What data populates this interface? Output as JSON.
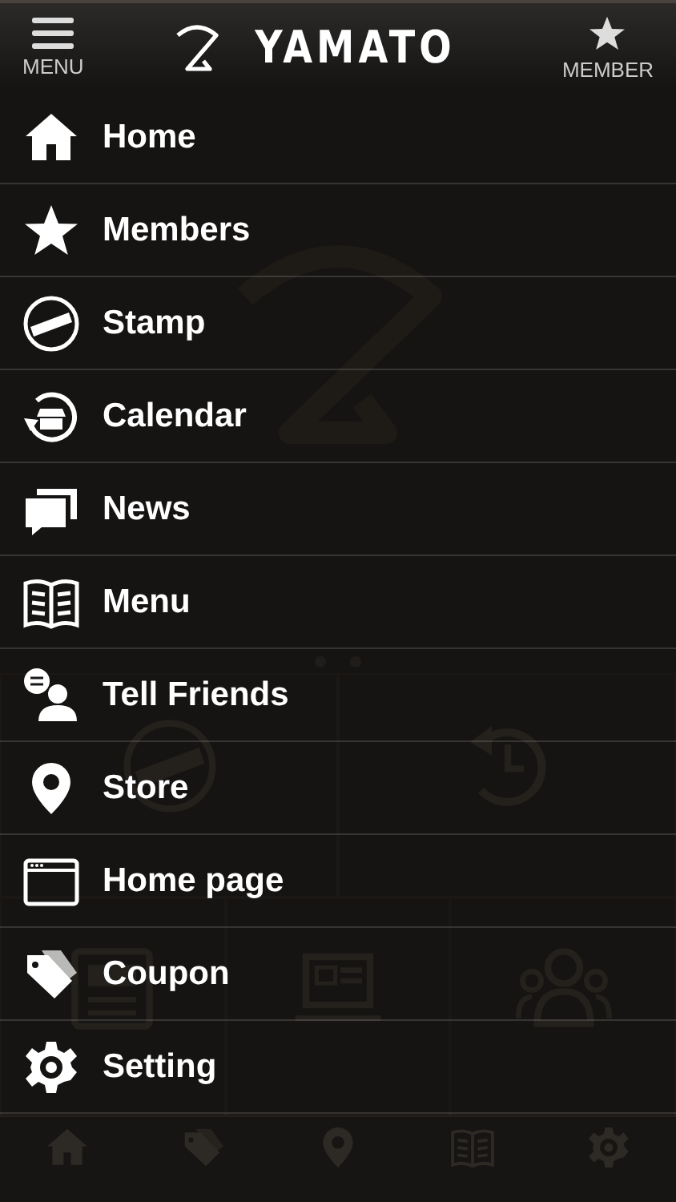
{
  "header": {
    "menu_button": "MENU",
    "logo": "YAMATO",
    "member_button": "MEMBER"
  },
  "menu": [
    {
      "label": "Home"
    },
    {
      "label": "Members"
    },
    {
      "label": "Stamp"
    },
    {
      "label": "Calendar"
    },
    {
      "label": "News"
    },
    {
      "label": "Menu"
    },
    {
      "label": "Tell Friends"
    },
    {
      "label": "Store"
    },
    {
      "label": "Home page"
    },
    {
      "label": "Coupon"
    },
    {
      "label": "Setting"
    }
  ]
}
